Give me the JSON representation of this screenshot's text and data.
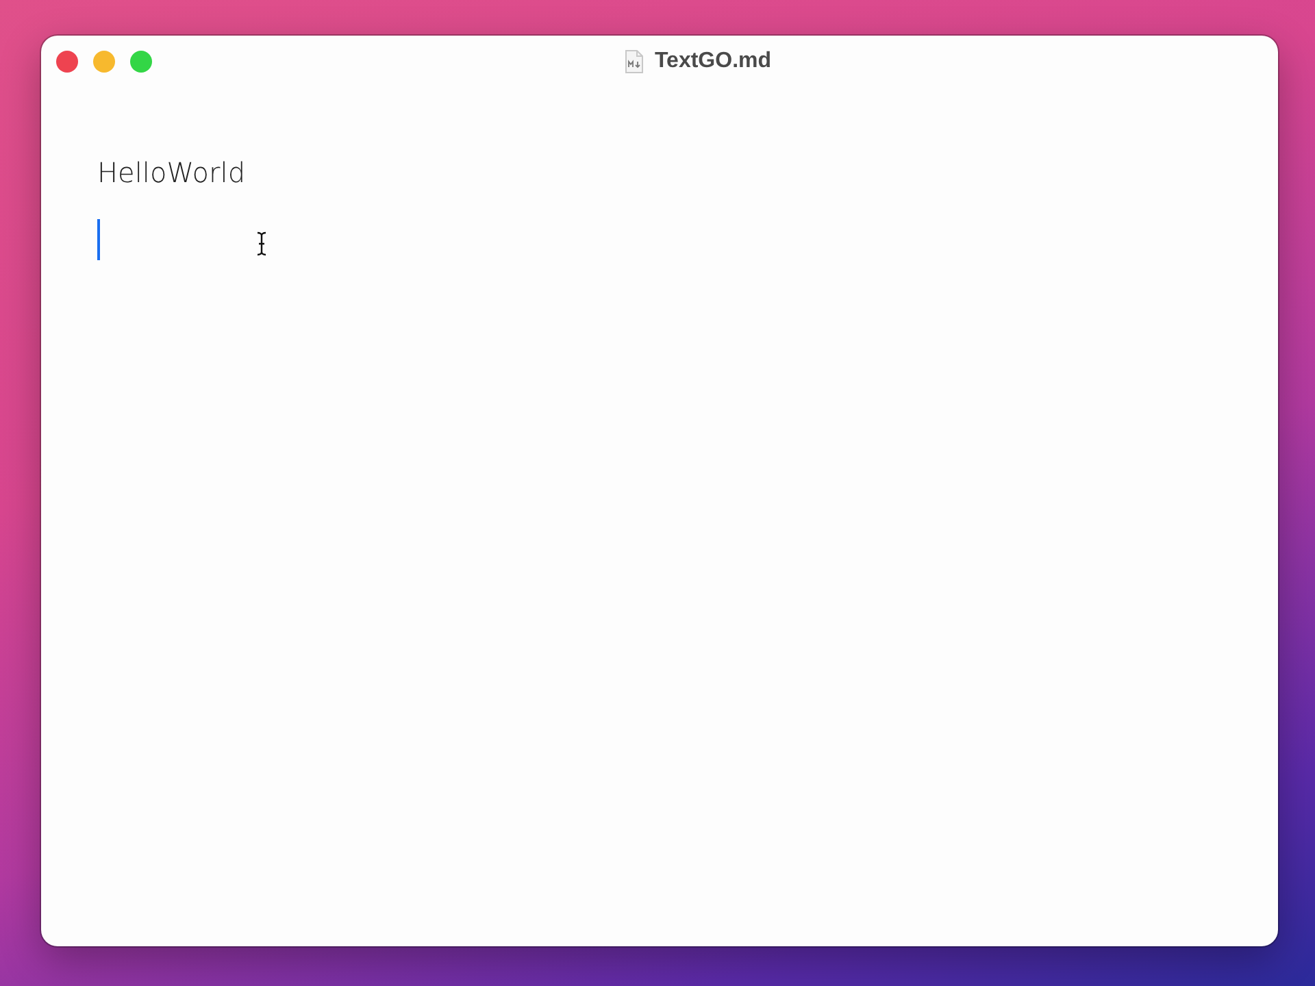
{
  "window": {
    "title": "TextGO.md"
  },
  "editor": {
    "paragraphs": [
      "HelloWorld"
    ]
  }
}
